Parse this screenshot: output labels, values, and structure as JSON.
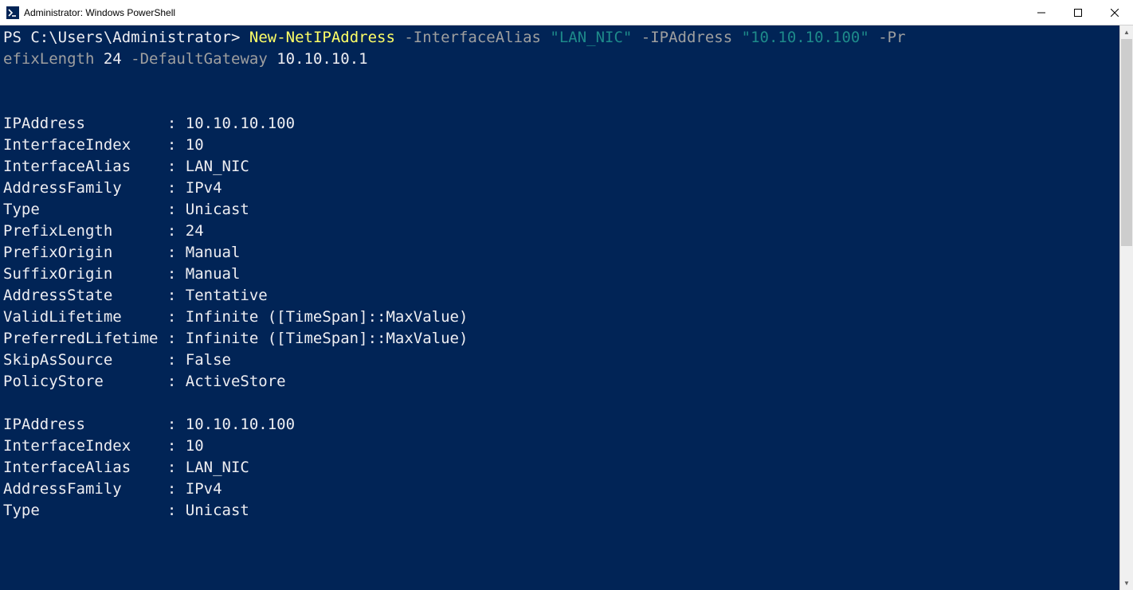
{
  "window": {
    "title": "Administrator: Windows PowerShell"
  },
  "prompt": {
    "ps": "PS ",
    "path": "C:\\Users\\Administrator",
    "arrow": "> "
  },
  "command": {
    "cmdlet": "New-NetIPAddress",
    "p1": " -InterfaceAlias ",
    "v1": "\"LAN_NIC\"",
    "p2": " -IPAddress ",
    "v2": "\"10.10.10.100\"",
    "p3": " -Pr",
    "p3b": "efixLength ",
    "v3": "24",
    "p4": " -DefaultGateway ",
    "v4": "10.10.10.1"
  },
  "block1": {
    "r0": {
      "k": "IPAddress         ",
      "v": ": 10.10.10.100"
    },
    "r1": {
      "k": "InterfaceIndex    ",
      "v": ": 10"
    },
    "r2": {
      "k": "InterfaceAlias    ",
      "v": ": LAN_NIC"
    },
    "r3": {
      "k": "AddressFamily     ",
      "v": ": IPv4"
    },
    "r4": {
      "k": "Type              ",
      "v": ": Unicast"
    },
    "r5": {
      "k": "PrefixLength      ",
      "v": ": 24"
    },
    "r6": {
      "k": "PrefixOrigin      ",
      "v": ": Manual"
    },
    "r7": {
      "k": "SuffixOrigin      ",
      "v": ": Manual"
    },
    "r8": {
      "k": "AddressState      ",
      "v": ": Tentative"
    },
    "r9": {
      "k": "ValidLifetime     ",
      "v": ": Infinite ([TimeSpan]::MaxValue)"
    },
    "r10": {
      "k": "PreferredLifetime ",
      "v": ": Infinite ([TimeSpan]::MaxValue)"
    },
    "r11": {
      "k": "SkipAsSource      ",
      "v": ": False"
    },
    "r12": {
      "k": "PolicyStore       ",
      "v": ": ActiveStore"
    }
  },
  "block2": {
    "r0": {
      "k": "IPAddress         ",
      "v": ": 10.10.10.100"
    },
    "r1": {
      "k": "InterfaceIndex    ",
      "v": ": 10"
    },
    "r2": {
      "k": "InterfaceAlias    ",
      "v": ": LAN_NIC"
    },
    "r3": {
      "k": "AddressFamily     ",
      "v": ": IPv4"
    },
    "r4": {
      "k": "Type              ",
      "v": ": Unicast"
    }
  }
}
